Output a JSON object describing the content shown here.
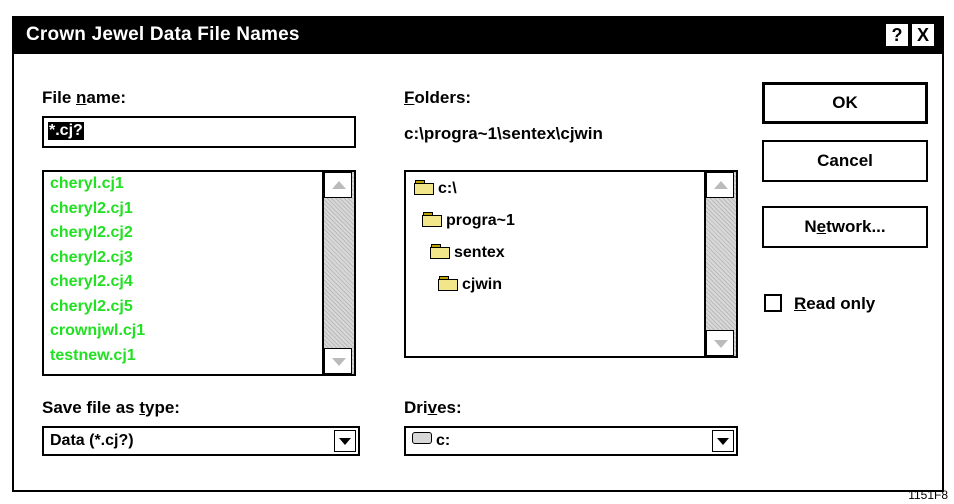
{
  "window": {
    "title": "Crown Jewel Data File Names",
    "help_glyph": "?",
    "close_glyph": "X"
  },
  "file_name": {
    "label_pre": "File ",
    "label_accel": "n",
    "label_post": "ame:",
    "value": "*.cj?",
    "list": [
      "cheryl.cj1",
      "cheryl2.cj1",
      "cheryl2.cj2",
      "cheryl2.cj3",
      "cheryl2.cj4",
      "cheryl2.cj5",
      "crownjwl.cj1",
      "testnew.cj1"
    ],
    "list_color": "#22e022"
  },
  "folders": {
    "label_accel": "F",
    "label_post": "olders:",
    "current_path": "c:\\progra~1\\sentex\\cjwin",
    "tree": [
      "c:\\",
      "progra~1",
      "sentex",
      "cjwin"
    ]
  },
  "save_type": {
    "label_pre": "Save file as ",
    "label_accel": "t",
    "label_post": "ype:",
    "value": "Data (*.cj?)"
  },
  "drives": {
    "label_pre": "Dri",
    "label_accel": "v",
    "label_post": "es:",
    "value": "c:"
  },
  "buttons": {
    "ok": "OK",
    "cancel": "Cancel",
    "network_pre": "N",
    "network_accel": "e",
    "network_post": "twork..."
  },
  "read_only": {
    "label_accel": "R",
    "label_post": "ead only",
    "checked": false
  },
  "figure_id": "1151F8",
  "icons": {
    "folder": "folder-open-icon",
    "drive": "hard-drive-icon",
    "scroll_up": "scroll-up-arrow-icon",
    "scroll_down": "scroll-down-arrow-icon",
    "dropdown": "dropdown-arrow-icon"
  }
}
